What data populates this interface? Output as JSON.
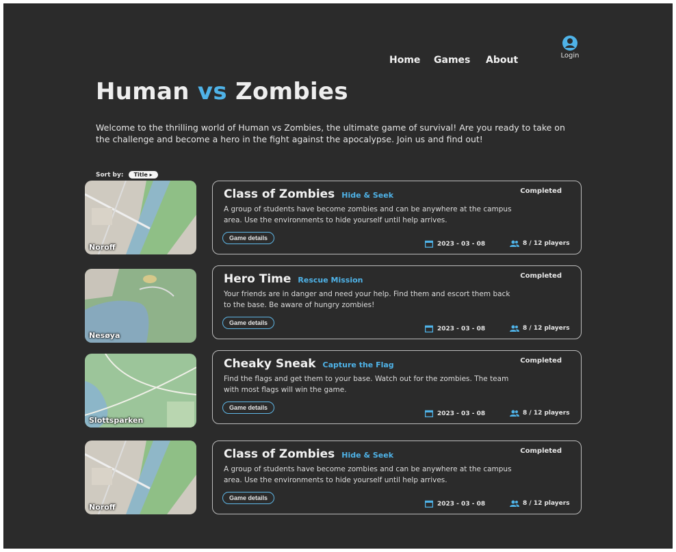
{
  "nav": {
    "home": "Home",
    "games": "Games",
    "about": "About",
    "login": "Login"
  },
  "header": {
    "title_part1": "Human ",
    "title_vs": "vs",
    "title_part2": " Zombies",
    "intro": "Welcome to the thrilling world of Human vs Zombies, the ultimate game of survival! Are you ready to take on the challenge and become a hero in the fight against the apocalypse. Join us and find out!"
  },
  "sort": {
    "label": "Sort by:",
    "value": "Title"
  },
  "colors": {
    "accent": "#4fb3e8",
    "background": "#2b2b2b"
  },
  "games": [
    {
      "location": "Noroff",
      "title": "Class of Zombies",
      "genre": "Hide & Seek",
      "status": "Completed",
      "description": "A group of students have become zombies and can be anywhere at the campus area. Use the environments to hide yourself until help arrives.",
      "details_label": "Game details",
      "date": "2023 - 03 - 08",
      "players": "8 / 12 players"
    },
    {
      "location": "Nesøya",
      "title": "Hero Time",
      "genre": "Rescue Mission",
      "status": "Completed",
      "description": "Your friends are in danger and need your help. Find them and escort them back to the base. Be aware of hungry zombies!",
      "details_label": "Game details",
      "date": "2023 - 03 - 08",
      "players": "8 / 12 players"
    },
    {
      "location": "Slottsparken",
      "title": "Cheaky Sneak",
      "genre": "Capture the Flag",
      "status": "Completed",
      "description": "Find the flags and get them to your base. Watch out for the zombies. The team with most flags will win the game.",
      "details_label": "Game details",
      "date": "2023 - 03 - 08",
      "players": "8 / 12 players"
    },
    {
      "location": "Noroff",
      "title": "Class of Zombies",
      "genre": "Hide & Seek",
      "status": "Completed",
      "description": "A group of students have become zombies and can be anywhere at the campus area. Use the environments to hide yourself until help arrives.",
      "details_label": "Game details",
      "date": "2023 - 03 - 08",
      "players": "8 / 12 players"
    }
  ]
}
